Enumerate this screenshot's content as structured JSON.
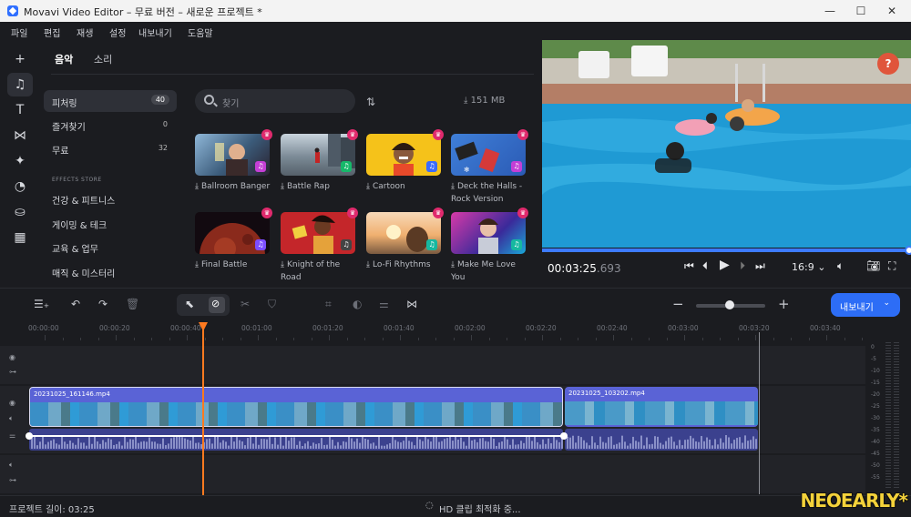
{
  "window": {
    "title": "Movavi Video Editor – 무료 버전 – 새로운 프로젝트 *",
    "minimize": "—",
    "maximize": "☐",
    "close": "✕"
  },
  "menu": [
    "파일",
    "편집",
    "재생",
    "설정",
    "내보내기",
    "도움말"
  ],
  "tools": [
    {
      "name": "add-icon",
      "glyph": "+"
    },
    {
      "name": "music-icon",
      "glyph": "♫"
    },
    {
      "name": "text-icon",
      "glyph": "T"
    },
    {
      "name": "transitions-icon",
      "glyph": "⋈"
    },
    {
      "name": "effects-wand-icon",
      "glyph": "✦"
    },
    {
      "name": "stickers-icon",
      "glyph": "◔"
    },
    {
      "name": "store-bag-icon",
      "glyph": "⛀"
    },
    {
      "name": "more-tools-icon",
      "glyph": "▦"
    }
  ],
  "media": {
    "tabs": [
      "음악",
      "소리"
    ],
    "categories": [
      {
        "label": "피처링",
        "count": "40"
      },
      {
        "label": "즐겨찾기",
        "count": "0"
      },
      {
        "label": "무료",
        "count": "32"
      }
    ],
    "store_heading": "EFFECTS STORE",
    "store_items": [
      "건강 & 피트니스",
      "게이밍 & 테크",
      "교육 & 업무",
      "매직 & 미스터리"
    ],
    "search_placeholder": "찾기",
    "storage": "151 MB",
    "tracks": [
      {
        "title": "Ballroom Banger",
        "note_color": "#c43fd6",
        "thumb": "ballroom"
      },
      {
        "title": "Battle Rap",
        "note_color": "#16b86a",
        "thumb": "battle"
      },
      {
        "title": "Cartoon",
        "note_color": "#3b6bff",
        "thumb": "cartoon"
      },
      {
        "title": "Deck the Halls - Rock Version",
        "note_color": "#c43fd6",
        "thumb": "deck"
      },
      {
        "title": "Final Battle",
        "note_color": "#7c4dff",
        "thumb": "planet"
      },
      {
        "title": "Knight of the Road",
        "note_color": "#444",
        "thumb": "knight"
      },
      {
        "title": "Lo-Fi Rhythms",
        "note_color": "#16b8a0",
        "thumb": "lofi"
      },
      {
        "title": "Make Me Love You",
        "note_color": "#16b8a0",
        "thumb": "love"
      }
    ]
  },
  "preview": {
    "help": "?",
    "progress": 0.997,
    "timecode_main": "00:03:25",
    "timecode_ms": ".693",
    "aspect": "16:9",
    "aspect_chevron": "⌄"
  },
  "timeline": {
    "export_label": "내보내기",
    "ruler": [
      "00:00:00",
      "00:00:20",
      "00:00:40",
      "00:01:00",
      "00:01:20",
      "00:01:40",
      "00:02:00",
      "00:02:20",
      "00:02:40",
      "00:03:00",
      "00:03:20",
      "00:03:40"
    ],
    "clips": [
      {
        "name": "20231025_161146.mp4"
      },
      {
        "name": "20231025_103202.mp4"
      }
    ],
    "meter_labels": [
      "0",
      "-5",
      "-10",
      "-15",
      "-20",
      "-25",
      "-30",
      "-35",
      "-40",
      "-45",
      "-50",
      "-55"
    ]
  },
  "status": {
    "project_length": "프로젝트 길이: 03:25",
    "optimizing": "HD 클립 최적화 중...",
    "watermark": "NEOEARLY*"
  }
}
